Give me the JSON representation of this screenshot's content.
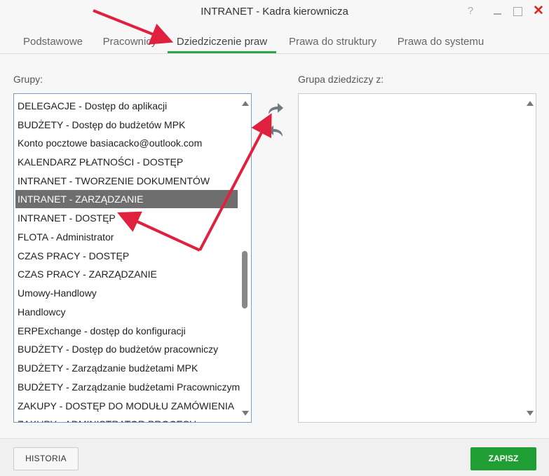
{
  "window": {
    "title": "INTRANET - Kadra kierownicza",
    "help_label": "?",
    "close_label": "✕"
  },
  "tabs": [
    {
      "label": "Podstawowe"
    },
    {
      "label": "Pracownicy"
    },
    {
      "label": "Dziedziczenie praw",
      "active": true
    },
    {
      "label": "Prawa do struktury"
    },
    {
      "label": "Prawa do systemu"
    }
  ],
  "left_panel": {
    "label": "Grupy:",
    "items": [
      "DELEGACJE - Dostęp do aplikacji",
      "BUDŻETY - Dostęp do budżetów MPK",
      "Konto pocztowe basiacacko@outlook.com",
      "KALENDARZ PŁATNOŚCI - DOSTĘP",
      "INTRANET - TWORZENIE DOKUMENTÓW",
      "INTRANET - ZARZĄDZANIE",
      "INTRANET - DOSTĘP",
      "FLOTA - Administrator",
      "CZAS PRACY - DOSTĘP",
      "CZAS PRACY - ZARZĄDZANIE",
      "Umowy-Handlowy",
      "Handlowcy",
      "ERPExchange - dostęp do konfiguracji",
      "BUDŻETY - Dostęp do budżetów pracowniczy",
      "BUDŻETY - Zarządzanie budżetami MPK",
      "BUDŻETY - Zarządzanie budżetami Pracowniczym",
      "ZAKUPY - DOSTĘP DO MODUŁU ZAMÓWIENIA",
      "ZAKUPY - ADMINISTRATOR PROCESU"
    ],
    "selected_index": 5
  },
  "right_panel": {
    "label": "Grupa dziedziczy z:",
    "items": []
  },
  "footer": {
    "history_label": "HISTORIA",
    "save_label": "ZAPISZ"
  },
  "colors": {
    "accent_tab": "#2aa642",
    "save_button": "#1e9e33",
    "selected_row": "#6e6e6e",
    "annotation_arrow": "#e0213e",
    "close_icon": "#e02020"
  }
}
